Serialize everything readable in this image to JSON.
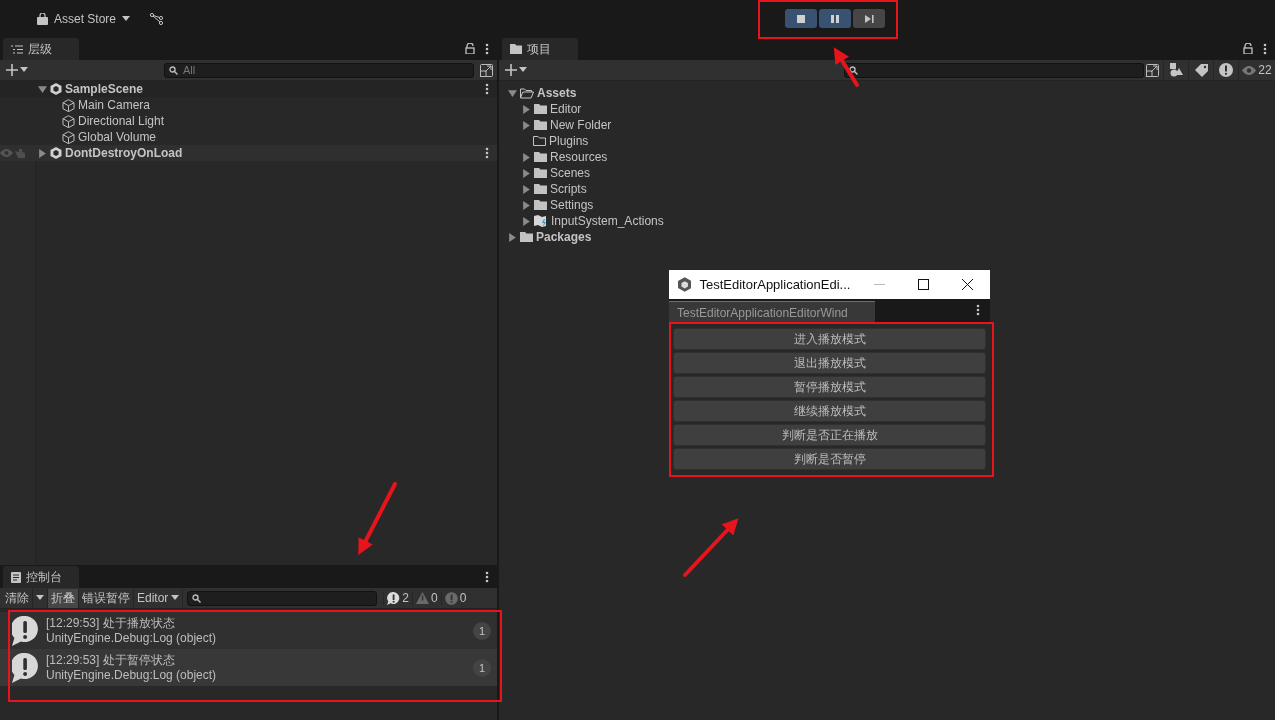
{
  "toolbar": {
    "asset_store": "Asset Store",
    "play_controls": [
      {
        "kind": "stop",
        "on": true
      },
      {
        "kind": "pause",
        "on": true
      },
      {
        "kind": "step",
        "on": false
      }
    ]
  },
  "hierarchy": {
    "tab": "层级",
    "search": {
      "placeholder": "All"
    },
    "items": [
      {
        "kind": "scene",
        "label": "SampleScene",
        "expanded": true,
        "children": [
          {
            "kind": "gameobject",
            "label": "Main Camera"
          },
          {
            "kind": "gameobject",
            "label": "Directional Light"
          },
          {
            "kind": "gameobject",
            "label": "Global Volume"
          }
        ]
      },
      {
        "kind": "scene",
        "label": "DontDestroyOnLoad",
        "expanded": false
      }
    ]
  },
  "console": {
    "tab": "控制台",
    "buttons": [
      {
        "kind": "clear",
        "label": "清除",
        "on": false
      },
      {
        "kind": "collapse",
        "label": "折叠",
        "on": true
      },
      {
        "kind": "error_pause",
        "label": "错误暂停",
        "on": false
      },
      {
        "kind": "dropdown",
        "label": "Editor",
        "on": false
      }
    ],
    "counts": [
      {
        "kind": "info",
        "count": "2"
      },
      {
        "kind": "warning",
        "count": "0"
      },
      {
        "kind": "error",
        "count": "0"
      }
    ],
    "logs": [
      {
        "message": "[12:29:53] 处于播放状态",
        "trace": "UnityEngine.Debug:Log (object)",
        "count": "1"
      },
      {
        "message": "[12:29:53] 处于暂停状态",
        "trace": "UnityEngine.Debug:Log (object)",
        "count": "1"
      }
    ]
  },
  "project": {
    "tab": "项目",
    "hidden_count": "22",
    "items": [
      {
        "kind": "folder",
        "label": "Assets",
        "expanded": true,
        "children": [
          {
            "kind": "folder",
            "label": "Editor",
            "expanded": false
          },
          {
            "kind": "folder",
            "label": "New Folder",
            "expanded": false
          },
          {
            "kind": "empty_folder",
            "label": "Plugins"
          },
          {
            "kind": "folder",
            "label": "Resources",
            "expanded": false
          },
          {
            "kind": "folder",
            "label": "Scenes",
            "expanded": false
          },
          {
            "kind": "folder",
            "label": "Scripts",
            "expanded": false
          },
          {
            "kind": "folder",
            "label": "Settings",
            "expanded": false
          },
          {
            "kind": "input_actions",
            "label": "InputSystem_Actions",
            "expanded": false
          }
        ]
      },
      {
        "kind": "folder",
        "label": "Packages",
        "expanded": false
      }
    ]
  },
  "editor_window": {
    "title": "TestEditorApplicationEdi...",
    "tab": "TestEditorApplicationEditorWind",
    "buttons": [
      "进入播放模式",
      "退出播放模式",
      "暂停播放模式",
      "继续播放模式",
      "判断是否正在播放",
      "判断是否暂停"
    ]
  }
}
